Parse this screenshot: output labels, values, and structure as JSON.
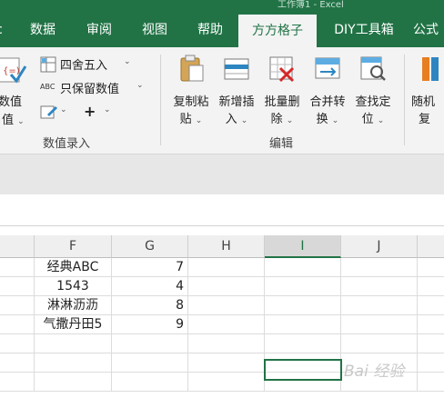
{
  "window": {
    "title_fragment": "工作簿1 - Excel"
  },
  "tabs": [
    {
      "label": "数据"
    },
    {
      "label": "审阅"
    },
    {
      "label": "视图"
    },
    {
      "label": "帮助"
    },
    {
      "label": "方方格子"
    },
    {
      "label": "DIY工具箱"
    },
    {
      "label": "公式"
    }
  ],
  "ribbon": {
    "numvalue": {
      "label": "数值",
      "sub": "值"
    },
    "round": {
      "label": "四舍五入"
    },
    "keep_value": {
      "prefix": "ABC",
      "label": "只保留数值"
    },
    "plus": "+",
    "group1_label": "数值录入",
    "group2_label": "编辑",
    "copy_paste": {
      "line1": "复制粘",
      "line2": "贴"
    },
    "insert": {
      "line1": "新增插",
      "line2": "入"
    },
    "batch_delete": {
      "line1": "批量删",
      "line2": "除"
    },
    "merge": {
      "line1": "合并转",
      "line2": "换"
    },
    "find": {
      "line1": "查找定",
      "line2": "位"
    },
    "random": {
      "line1": "随机",
      "line2": "复"
    }
  },
  "columns": [
    "F",
    "G",
    "H",
    "I",
    "J"
  ],
  "selected_column": "I",
  "rows": [
    {
      "f": "经典ABC",
      "g": "7"
    },
    {
      "f": "1543",
      "g": "4"
    },
    {
      "f": "淋淋沥沥",
      "g": "8"
    },
    {
      "f": "气撒丹田5",
      "g": "9"
    }
  ],
  "watermark": "Bai 经验",
  "colors": {
    "accent": "#217346",
    "ribbon_bg": "#f3f3f3"
  }
}
